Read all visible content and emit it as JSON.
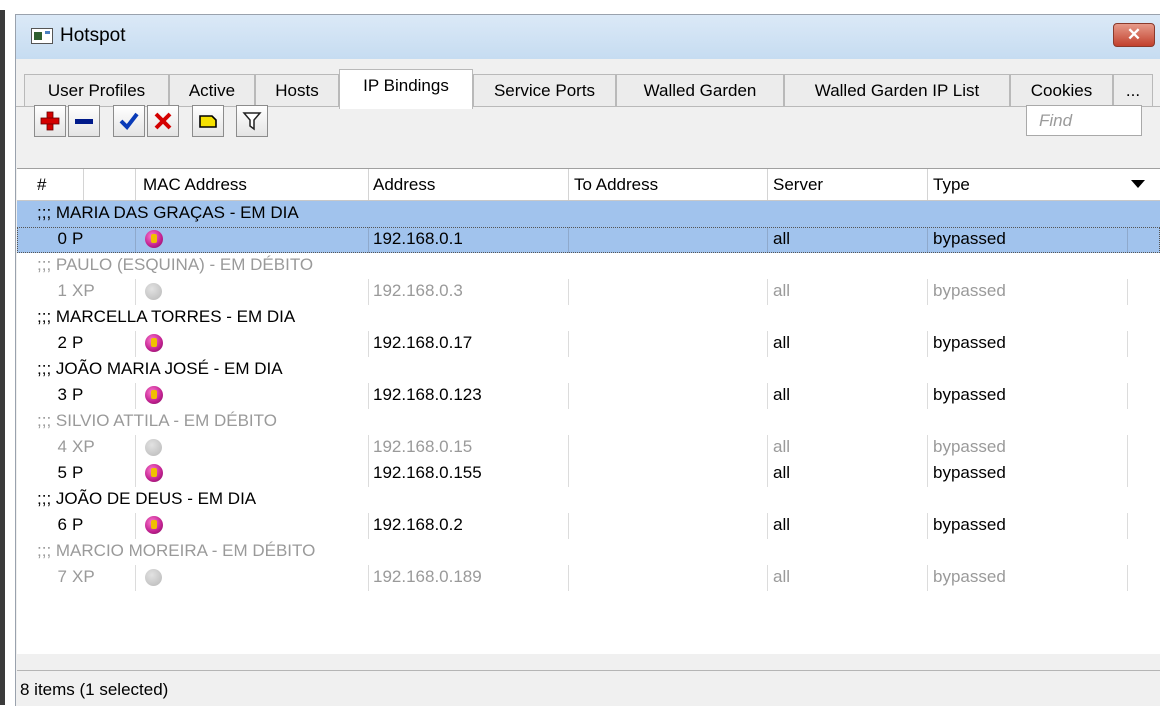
{
  "window": {
    "title": "Hotspot",
    "close_label": "✕"
  },
  "tabs": [
    {
      "label": "User Profiles"
    },
    {
      "label": "Active"
    },
    {
      "label": "Hosts"
    },
    {
      "label": "IP Bindings",
      "active": true
    },
    {
      "label": "Service Ports"
    },
    {
      "label": "Walled Garden"
    },
    {
      "label": "Walled Garden IP List"
    },
    {
      "label": "Cookies"
    },
    {
      "label": "..."
    }
  ],
  "toolbar": {
    "add_icon": "plus-icon",
    "remove_icon": "minus-icon",
    "enable_icon": "check-icon",
    "disable_icon": "x-icon",
    "comment_icon": "note-icon",
    "filter_icon": "filter-icon",
    "find_placeholder": "Find",
    "colors": {
      "add": "#d40000",
      "remove": "#001a8a",
      "enable": "#0a3bb8",
      "disable": "#d40000",
      "note": "#f5e000"
    }
  },
  "table": {
    "columns": [
      "#",
      "",
      "MAC Address",
      "Address",
      "To Address",
      "Server",
      "Type"
    ],
    "rows": [
      {
        "kind": "comment",
        "text": ";;; MARIA DAS GRAÇAS - EM DIA",
        "selected": true
      },
      {
        "kind": "data",
        "num": "0",
        "flags": "P",
        "icon": "dynamic-icon",
        "address": "192.168.0.1",
        "server": "all",
        "type": "bypassed",
        "selected": true
      },
      {
        "kind": "comment",
        "text": ";;; PAULO (ESQUINA) - EM DÉBITO",
        "disabled": true
      },
      {
        "kind": "data",
        "num": "1",
        "flags": "XP",
        "icon": "disabled-icon",
        "address": "192.168.0.3",
        "server": "all",
        "type": "bypassed",
        "disabled": true
      },
      {
        "kind": "comment",
        "text": ";;; MARCELLA TORRES - EM DIA"
      },
      {
        "kind": "data",
        "num": "2",
        "flags": "P",
        "icon": "dynamic-icon",
        "address": "192.168.0.17",
        "server": "all",
        "type": "bypassed"
      },
      {
        "kind": "comment",
        "text": ";;; JOÃO MARIA JOSÉ - EM DIA"
      },
      {
        "kind": "data",
        "num": "3",
        "flags": "P",
        "icon": "dynamic-icon",
        "address": "192.168.0.123",
        "server": "all",
        "type": "bypassed"
      },
      {
        "kind": "comment",
        "text": ";;; SILVIO ATTILA - EM DÉBITO",
        "disabled": true
      },
      {
        "kind": "data",
        "num": "4",
        "flags": "XP",
        "icon": "disabled-icon",
        "address": "192.168.0.15",
        "server": "all",
        "type": "bypassed",
        "disabled": true
      },
      {
        "kind": "data",
        "num": "5",
        "flags": "P",
        "icon": "dynamic-icon",
        "address": "192.168.0.155",
        "server": "all",
        "type": "bypassed"
      },
      {
        "kind": "comment",
        "text": ";;; JOÃO DE DEUS - EM DIA"
      },
      {
        "kind": "data",
        "num": "6",
        "flags": "P",
        "icon": "dynamic-icon",
        "address": "192.168.0.2",
        "server": "all",
        "type": "bypassed"
      },
      {
        "kind": "comment",
        "text": ";;; MARCIO MOREIRA - EM DÉBITO",
        "disabled": true
      },
      {
        "kind": "data",
        "num": "7",
        "flags": "XP",
        "icon": "disabled-icon",
        "address": "192.168.0.189",
        "server": "all",
        "type": "bypassed",
        "disabled": true
      }
    ]
  },
  "status": {
    "text": "8 items (1 selected)"
  }
}
